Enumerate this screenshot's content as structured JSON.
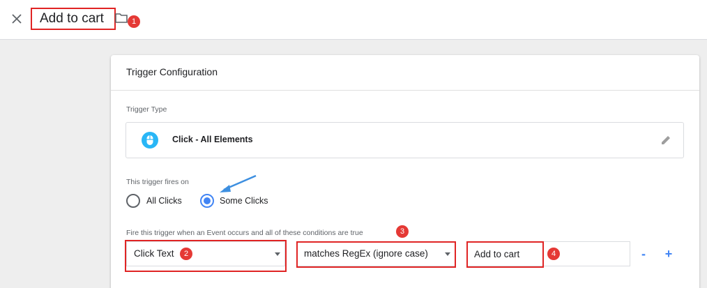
{
  "header": {
    "title": "Add to cart",
    "close_icon": "close-icon",
    "folder_icon": "folder-icon",
    "badge": "1"
  },
  "card": {
    "title": "Trigger Configuration",
    "trigger_type_label": "Trigger Type",
    "trigger_type_name": "Click - All Elements",
    "trigger_type_icon": "mouse-icon",
    "edit_icon": "pencil-icon",
    "fires_on_label": "This trigger fires on",
    "radio_options": [
      {
        "label": "All Clicks",
        "checked": false
      },
      {
        "label": "Some Clicks",
        "checked": true
      }
    ],
    "conditions_label": "Fire this trigger when an Event occurs and all of these conditions are true",
    "conditions_badge": "3",
    "condition": {
      "variable": "Click Text",
      "variable_badge": "2",
      "operator": "matches RegEx (ignore case)",
      "value": "Add to cart",
      "value_badge": "4"
    },
    "remove_label": "-",
    "add_label": "+"
  },
  "colors": {
    "accent": "#4285f4",
    "highlight_red": "#e02424",
    "badge_red": "#e53935",
    "background": "#eeeeee"
  }
}
